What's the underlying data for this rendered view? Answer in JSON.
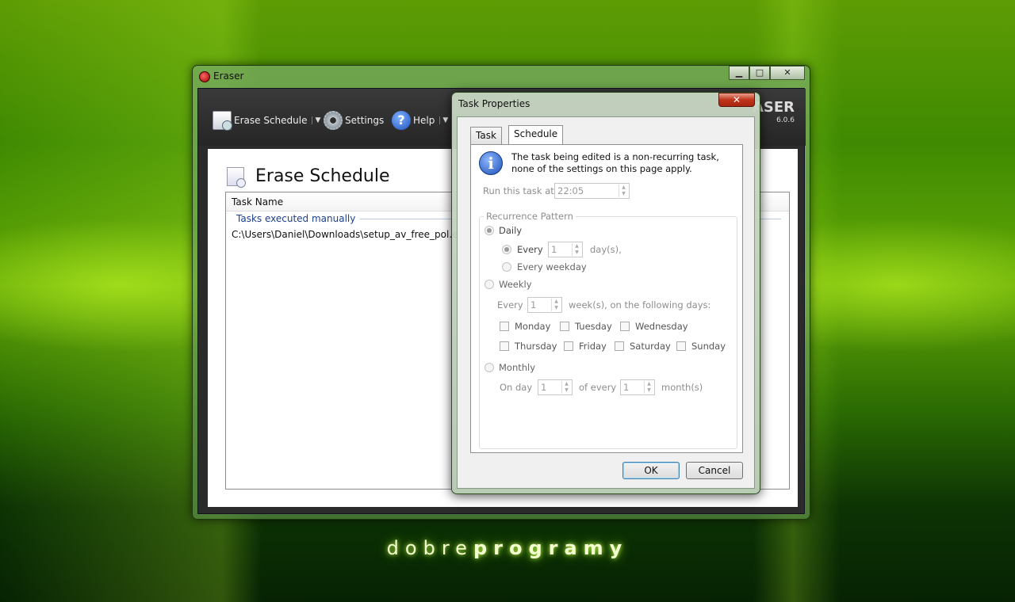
{
  "desktop": {
    "brand_light": "dobre",
    "brand_bold": "programy"
  },
  "window": {
    "title": "Eraser",
    "caption": {
      "minimize": "▁",
      "maximize": "□",
      "close": "✕"
    },
    "toolbar": {
      "erase_schedule": "Erase Schedule",
      "settings": "Settings",
      "help": "Help",
      "help_icon_glyph": "?",
      "dropdown_glyph": "▼"
    },
    "brand": {
      "name": "ASER",
      "version": "6.0.6"
    },
    "page_title": "Erase Schedule",
    "list": {
      "column_header": "Task Name",
      "group_label": "Tasks executed manually",
      "rows": [
        "C:\\Users\\Daniel\\Downloads\\setup_av_free_pol.exe"
      ]
    }
  },
  "dialog": {
    "title": "Task Properties",
    "close_glyph": "✕",
    "tabs": [
      "Task",
      "Schedule"
    ],
    "active_tab": "Schedule",
    "info_glyph": "i",
    "info_text": "The task being edited is a non-recurring task, none of the settings on this page apply.",
    "run_at_label": "Run this task at:",
    "run_at_value": "22:05",
    "recurrence_legend": "Recurrence Pattern",
    "daily": {
      "label": "Daily",
      "every_label": "Every",
      "every_value": "1",
      "days_suffix": "day(s),",
      "weekday_label": "Every weekday"
    },
    "weekly": {
      "label": "Weekly",
      "every_label": "Every",
      "every_value": "1",
      "suffix": "week(s), on the following days:",
      "days": [
        "Monday",
        "Tuesday",
        "Wednesday",
        "Thursday",
        "Friday",
        "Saturday",
        "Sunday"
      ]
    },
    "monthly": {
      "label": "Monthly",
      "on_day_label": "On day",
      "day_value": "1",
      "of_every_label": "of every",
      "month_value": "1",
      "months_suffix": "month(s)"
    },
    "buttons": {
      "ok": "OK",
      "cancel": "Cancel"
    }
  }
}
